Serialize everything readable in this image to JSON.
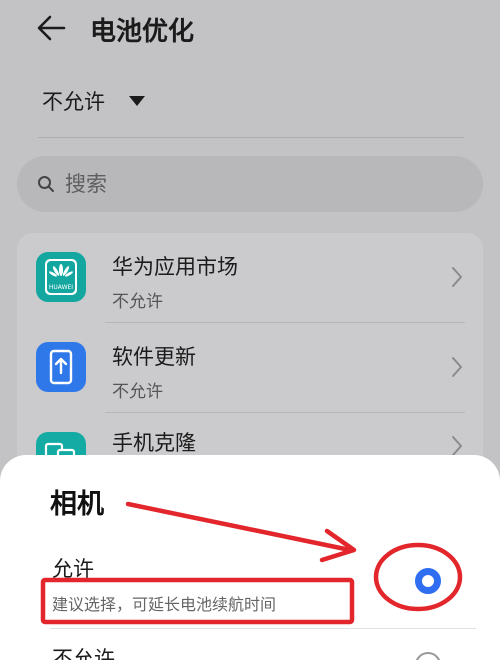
{
  "header": {
    "title": "电池优化",
    "back_icon": "back-arrow-icon"
  },
  "filter": {
    "label": "不允许",
    "dropdown_icon": "triangle-down-icon"
  },
  "search": {
    "placeholder": "搜索",
    "icon": "search-icon"
  },
  "apps": [
    {
      "name": "华为应用市场",
      "status": "不允许",
      "icon": "huawei-appgallery-icon",
      "icon_text": "HUAWEI",
      "color": "#14a7a0"
    },
    {
      "name": "软件更新",
      "status": "不允许",
      "icon": "software-update-icon",
      "color": "#2f78ea"
    },
    {
      "name": "手机克隆",
      "status": "",
      "icon": "phone-clone-icon",
      "color": "#13aba3"
    }
  ],
  "sheet": {
    "title": "相机",
    "options": [
      {
        "label": "允许",
        "description": "建议选择，可延长电池续航时间",
        "selected": true
      },
      {
        "label": "不允许",
        "selected": false
      }
    ]
  },
  "colors": {
    "accent": "#2f6df1",
    "annotation": "#e2262b"
  }
}
